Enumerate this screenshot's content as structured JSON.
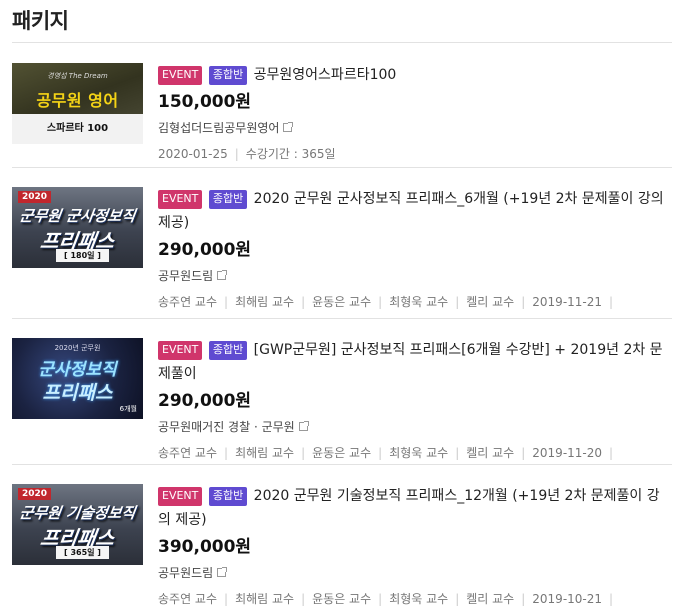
{
  "section": {
    "title": "패키지"
  },
  "items": [
    {
      "thumb": {
        "small": "경영섭 The Dream",
        "line1": "공무원 영어",
        "line2": "스파르타 100"
      },
      "badge_event": "EVENT",
      "badge_combo": "종합반",
      "title": "공무원영어스파르타100",
      "price": "150,000원",
      "provider": "김형섭더드림공무원영어",
      "meta": [
        "2020-01-25",
        "수강기간 : 365일"
      ]
    },
    {
      "thumb": {
        "year": "2020",
        "line1": "군무원 군사정보직",
        "line2": "프리패스",
        "pill": "[ 180일 ]"
      },
      "badge_event": "EVENT",
      "badge_combo": "종합반",
      "title": "2020 군무원 군사정보직 프리패스_6개월 (+19년 2차 문제풀이 강의 제공)",
      "price": "290,000원",
      "provider": "공무원드림",
      "meta": [
        "송주연 교수",
        "최해림 교수",
        "윤동은 교수",
        "최형욱 교수",
        "켈리 교수",
        "2019-11-21"
      ]
    },
    {
      "thumb": {
        "top": "2020년 군무원",
        "line1": "군사정보직",
        "line2": "프리패스",
        "tag": "6개월"
      },
      "badge_event": "EVENT",
      "badge_combo": "종합반",
      "title": "[GWP군무원] 군사정보직 프리패스[6개월 수강반] + 2019년 2차 문제풀이",
      "price": "290,000원",
      "provider": "공무원매거진 경찰 · 군무원",
      "meta": [
        "송주연 교수",
        "최해림 교수",
        "윤동은 교수",
        "최형욱 교수",
        "켈리 교수",
        "2019-11-20"
      ]
    },
    {
      "thumb": {
        "year": "2020",
        "line1": "군무원 기술정보직",
        "line2": "프리패스",
        "pill": "[ 365일 ]"
      },
      "badge_event": "EVENT",
      "badge_combo": "종합반",
      "title": "2020 군무원 기술정보직 프리패스_12개월 (+19년 2차 문제풀이 강의 제공)",
      "price": "390,000원",
      "provider": "공무원드림",
      "meta": [
        "송주연 교수",
        "최해림 교수",
        "윤동은 교수",
        "최형욱 교수",
        "켈리 교수",
        "2019-10-21"
      ]
    }
  ]
}
